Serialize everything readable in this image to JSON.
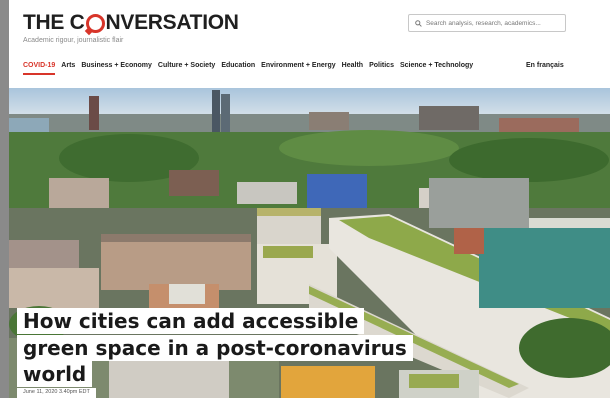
{
  "site": {
    "logo_text_before": "THE C",
    "logo_text_after": "NVERSATION",
    "tagline": "Academic rigour, journalistic flair",
    "brand_color": "#d8352a"
  },
  "search": {
    "placeholder": "Search analysis, research, academics..."
  },
  "nav": {
    "items": [
      "COVID-19",
      "Arts",
      "Business + Economy",
      "Culture + Society",
      "Education",
      "Environment + Energy",
      "Health",
      "Politics",
      "Science + Technology"
    ],
    "active_index": 0,
    "language_link": "En français"
  },
  "article": {
    "headline_lines": [
      "How cities can add accessible",
      "green space in a post-coronavirus",
      "world"
    ],
    "dateline": "June 11, 2020 3.40pm EDT"
  },
  "icons": {
    "search": "search-icon",
    "logo_mark": "speech-bubble-icon"
  }
}
